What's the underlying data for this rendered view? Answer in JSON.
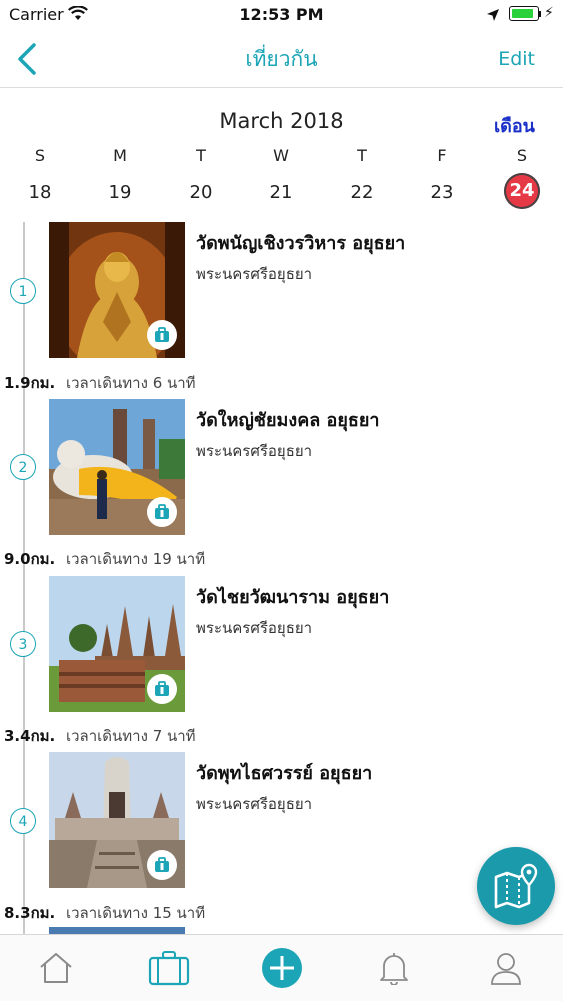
{
  "status": {
    "carrier": "Carrier",
    "time": "12:53 PM",
    "battery_level": 0.9
  },
  "nav": {
    "title": "เที่ยวกัน",
    "edit": "Edit"
  },
  "calendar": {
    "month": "March 2018",
    "mode": "เดือน",
    "weekdays": [
      "S",
      "M",
      "T",
      "W",
      "T",
      "F",
      "S"
    ],
    "dates": [
      "18",
      "19",
      "20",
      "21",
      "22",
      "23",
      "24"
    ],
    "selected_date": "24"
  },
  "places": [
    {
      "index": "1",
      "name": "วัดพนัญเชิงวรวิหาร อยุธยา",
      "province": "พระนครศรีอยุธยา"
    },
    {
      "index": "2",
      "name": "วัดใหญ่ชัยมงคล อยุธยา",
      "province": "พระนครศรีอยุธยา"
    },
    {
      "index": "3",
      "name": "วัดไชยวัฒนาราม อยุธยา",
      "province": "พระนครศรีอยุธยา"
    },
    {
      "index": "4",
      "name": "วัดพุทไธศวรรย์ อยุธยา",
      "province": "พระนครศรีอยุธยา"
    }
  ],
  "legs": [
    {
      "distance": "1.9กม.",
      "time": "เวลาเดินทาง 6 นาที"
    },
    {
      "distance": "9.0กม.",
      "time": "เวลาเดินทาง 19 นาที"
    },
    {
      "distance": "3.4กม.",
      "time": "เวลาเดินทาง 7 นาที"
    },
    {
      "distance": "8.3กม.",
      "time": "เวลาเดินทาง 15 นาที"
    }
  ],
  "icons": {
    "back": "chevron-left-icon",
    "fab": "map-pin-icon",
    "badge": "luggage-icon",
    "tabs": [
      "home-icon",
      "suitcase-icon",
      "plus-circle-icon",
      "bell-icon",
      "user-icon"
    ]
  },
  "colors": {
    "accent": "#1ba5b6",
    "selected_date": "#e53946",
    "month_toggle": "#1a30c8",
    "fab": "#1a9aab"
  }
}
